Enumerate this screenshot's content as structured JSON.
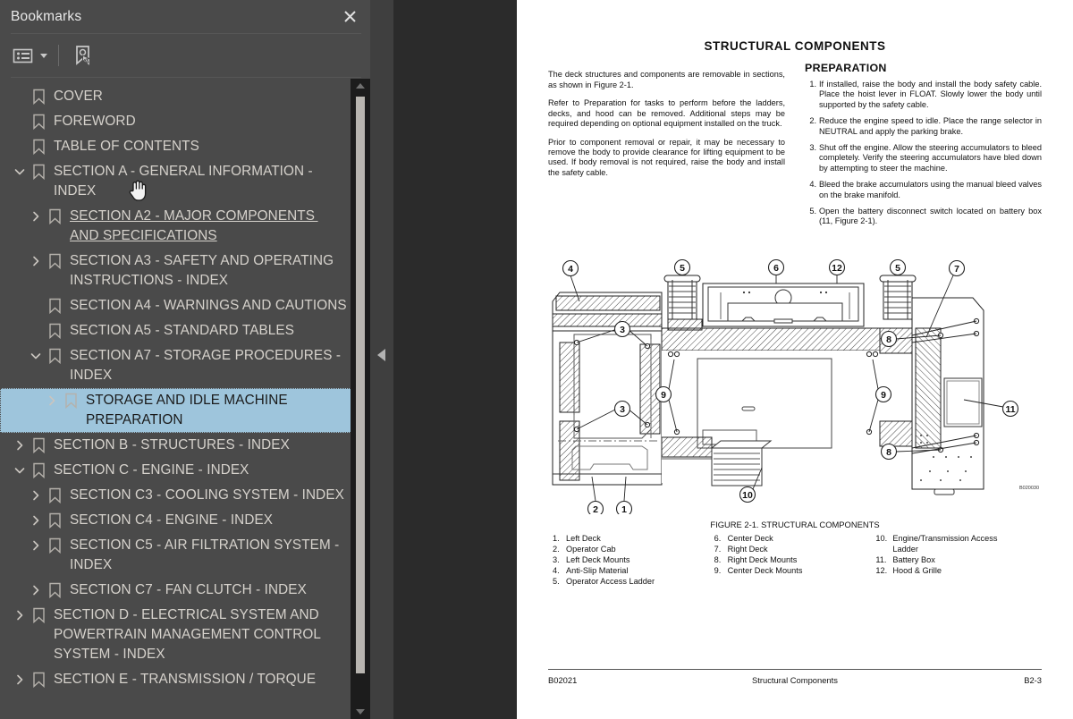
{
  "panel": {
    "title": "Bookmarks",
    "close_icon": "close-icon",
    "toolbar": {
      "options_icon": "list-options-icon",
      "new_bookmark_icon": "new-bookmark-icon"
    }
  },
  "tree": [
    {
      "level": 0,
      "twisty": "none",
      "label": "COVER"
    },
    {
      "level": 0,
      "twisty": "none",
      "label": "FOREWORD"
    },
    {
      "level": 0,
      "twisty": "none",
      "label": "TABLE OF CONTENTS"
    },
    {
      "level": 0,
      "twisty": "expanded",
      "label": "SECTION A - GENERAL INFORMATION - INDEX"
    },
    {
      "level": 1,
      "twisty": "collapsed",
      "label": "SECTION A2 - MAJOR COMPONENTS AND SPECIFICATIONS",
      "underlined": true
    },
    {
      "level": 1,
      "twisty": "collapsed",
      "label": "SECTION A3 - SAFETY AND OPERATING INSTRUCTIONS - INDEX"
    },
    {
      "level": 1,
      "twisty": "none",
      "label": "SECTION A4 - WARNINGS AND CAUTIONS"
    },
    {
      "level": 1,
      "twisty": "none",
      "label": "SECTION A5 - STANDARD TABLES"
    },
    {
      "level": 1,
      "twisty": "expanded",
      "label": "SECTION A7 - STORAGE PROCEDURES - INDEX"
    },
    {
      "level": 2,
      "twisty": "collapsed",
      "label": "STORAGE AND IDLE MACHINE PREPARATION",
      "selected": true
    },
    {
      "level": 0,
      "twisty": "collapsed",
      "label": "SECTION B - STRUCTURES - INDEX"
    },
    {
      "level": 0,
      "twisty": "expanded",
      "label": "SECTION C - ENGINE - INDEX"
    },
    {
      "level": 1,
      "twisty": "collapsed",
      "label": "SECTION C3 - COOLING SYSTEM - INDEX"
    },
    {
      "level": 1,
      "twisty": "collapsed",
      "label": "SECTION C4 - ENGINE - INDEX"
    },
    {
      "level": 1,
      "twisty": "collapsed",
      "label": "SECTION C5 - AIR FILTRATION SYSTEM - INDEX"
    },
    {
      "level": 1,
      "twisty": "collapsed",
      "label": "SECTION C7 - FAN CLUTCH - INDEX"
    },
    {
      "level": 0,
      "twisty": "collapsed",
      "label": "SECTION D - ELECTRICAL SYSTEM AND POWERTRAIN MANAGEMENT CONTROL SYSTEM - INDEX"
    },
    {
      "level": 0,
      "twisty": "collapsed",
      "label": "SECTION E - TRANSMISSION / TORQUE"
    }
  ],
  "document": {
    "title": "STRUCTURAL COMPONENTS",
    "left_column": [
      "The deck structures and components are removable in sections, as shown in Figure 2-1.",
      "Refer to Preparation for tasks to perform before the ladders, decks, and hood can be removed. Additional steps may be required depending on optional equipment installed on the truck.",
      "Prior to component removal or repair, it may be necessary to remove the body to provide clearance for lifting equipment to be used. If body removal is not required, raise the body and install the safety cable."
    ],
    "preparation_heading": "PREPARATION",
    "preparation_steps": [
      "If installed, raise the body and install the body safety cable. Place the hoist lever in FLOAT. Slowly lower the body until supported by the safety cable.",
      "Reduce the engine speed to idle. Place the range selector in NEUTRAL and apply the parking brake.",
      "Shut off the engine. Allow the steering accumulators to bleed completely. Verify the steering accumulators have bled down by attempting to steer the machine.",
      "Bleed the brake accumulators using the manual bleed valves on the brake manifold.",
      "Open the battery disconnect switch located on battery box (11, Figure 2-1)."
    ],
    "figure": {
      "caption": "FIGURE 2-1. STRUCTURAL COMPONENTS",
      "drawing_id": "B020030",
      "callouts": [
        "1",
        "2",
        "3",
        "3",
        "4",
        "5",
        "5",
        "6",
        "7",
        "8",
        "8",
        "9",
        "9",
        "10",
        "11",
        "12"
      ],
      "legend_columns": [
        [
          {
            "num": "1.",
            "text": "Left Deck"
          },
          {
            "num": "2.",
            "text": "Operator Cab"
          },
          {
            "num": "3.",
            "text": "Left Deck Mounts"
          },
          {
            "num": "4.",
            "text": "Anti-Slip Material"
          },
          {
            "num": "5.",
            "text": "Operator Access Ladder"
          }
        ],
        [
          {
            "num": "6.",
            "text": "Center Deck"
          },
          {
            "num": "7.",
            "text": "Right Deck"
          },
          {
            "num": "8.",
            "text": "Right Deck Mounts"
          },
          {
            "num": "9.",
            "text": "Center Deck Mounts"
          }
        ],
        [
          {
            "num": "10.",
            "text": "Engine/Transmission  Access",
            "continuation": "Ladder"
          },
          {
            "num": "11.",
            "text": "Battery Box"
          },
          {
            "num": "12.",
            "text": "Hood & Grille"
          }
        ]
      ]
    },
    "footer": {
      "left": "B02021",
      "center": "Structural Components",
      "right": "B2-3"
    }
  },
  "colors": {
    "panel_bg": "#4a4a4a",
    "selection": "#9ec5dc",
    "doc_bg": "#2b2b2b",
    "page": "#ffffff"
  }
}
